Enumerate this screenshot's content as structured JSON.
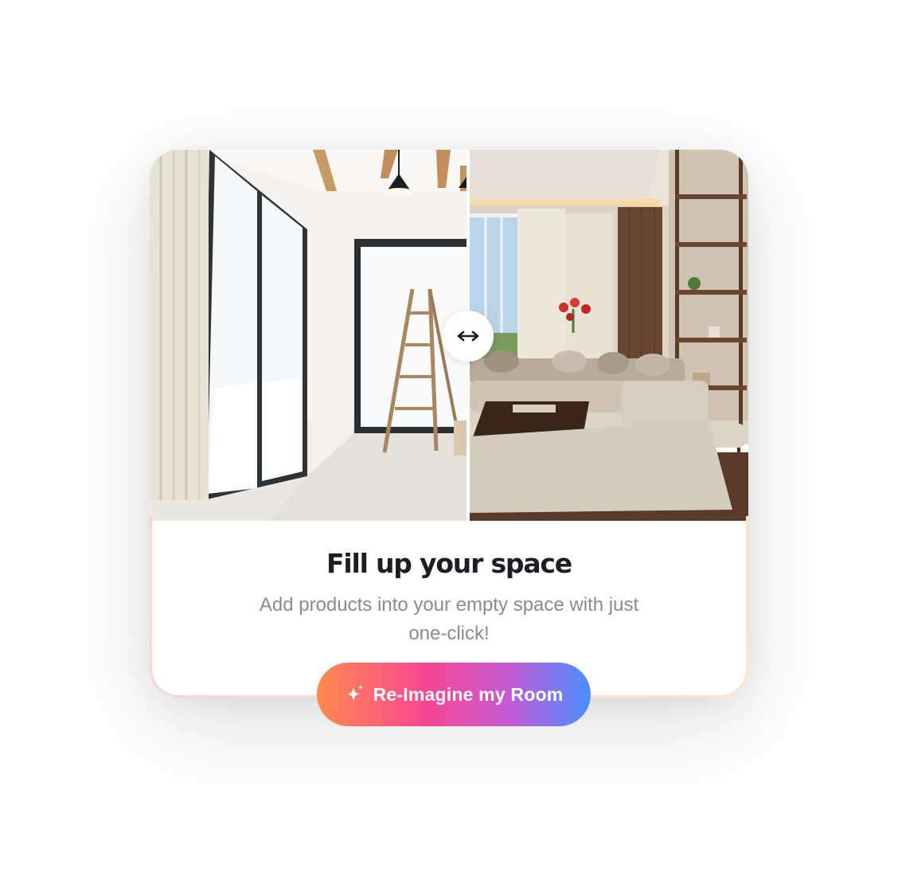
{
  "card": {
    "title": "Fill up your space",
    "subtitle": "Add products into your empty space with just one-click!"
  },
  "compare": {
    "before_image": "empty-room-photo",
    "after_image": "furnished-living-room-photo",
    "handle_icon": "horizontal-arrows-icon"
  },
  "cta": {
    "label": "Re-Imagine my Room",
    "icon": "sparkle-icon"
  },
  "colors": {
    "title": "#1d1d22",
    "subtitle": "#8a8a90",
    "cta_gradient": [
      "#fe8a4f",
      "#f74692",
      "#c45bd4",
      "#4a8efe"
    ]
  }
}
